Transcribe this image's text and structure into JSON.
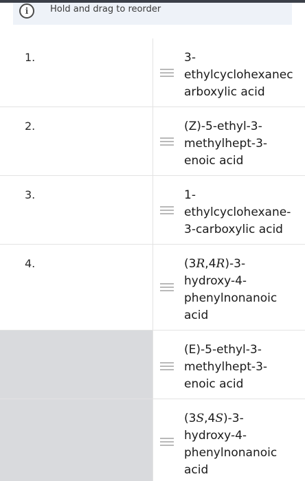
{
  "banner": {
    "icon": "info-icon",
    "text": "Hold and drag to reorder"
  },
  "rows": [
    {
      "number": "1.",
      "answer_lines": [
        "3-",
        "ethylcyclohexanec",
        "arboxylic acid"
      ]
    },
    {
      "number": "2.",
      "answer_lines": [
        "(Z)-5-ethyl-3-",
        "methylhept-3-",
        "enoic acid"
      ]
    },
    {
      "number": "3.",
      "answer_lines": [
        "1-",
        "ethylcyclohexane-",
        "3-carboxylic acid"
      ]
    },
    {
      "number": "4.",
      "answer_lines": [
        "(3R,4R)-3-",
        "hydroxy-4-",
        "phenylnonanoic",
        "acid"
      ]
    },
    {
      "number": "",
      "answer_lines": [
        "(E)-5-ethyl-3-",
        "methylhept-3-",
        "enoic acid"
      ]
    },
    {
      "number": "",
      "answer_lines": [
        "(3S,4S)-3-",
        "hydroxy-4-",
        "phenylnonanoic",
        "acid"
      ]
    }
  ]
}
